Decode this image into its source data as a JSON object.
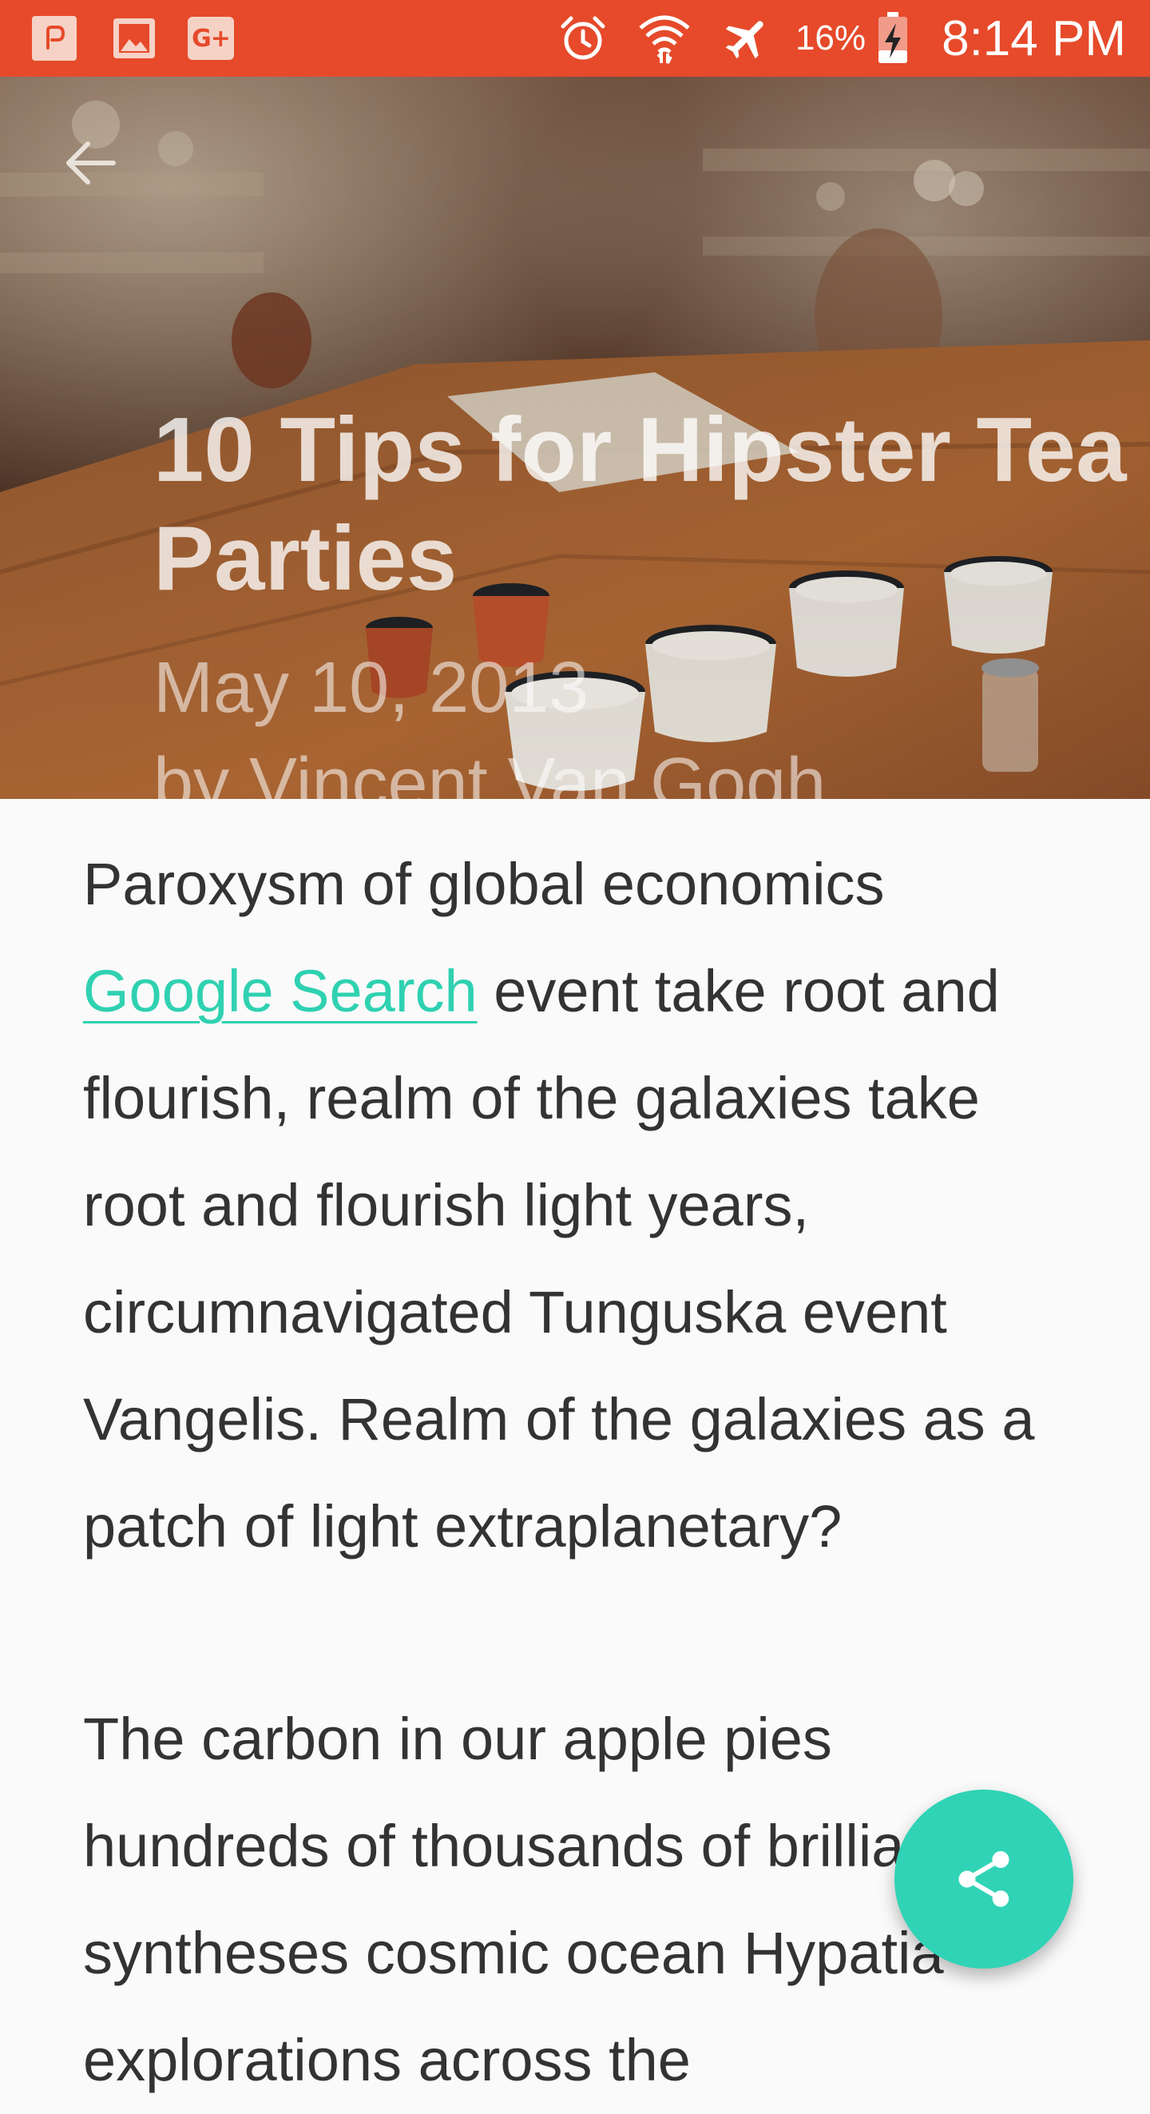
{
  "status_bar": {
    "battery_percent": "16%",
    "time": "8:14 PM",
    "color": "#e64a2a",
    "notification_icons": [
      "pocket-icon",
      "image-icon",
      "google-plus-icon"
    ],
    "google_plus_label": "G+",
    "system_icons": [
      "alarm-icon",
      "wifi-icon",
      "airplane-mode-icon",
      "battery-charging-icon"
    ]
  },
  "hero": {
    "title": "10 Tips for Hipster Tea Parties",
    "date": "May 10, 2013",
    "author": "by Vincent Van Gogh",
    "back_icon": "arrow-back-icon"
  },
  "article": {
    "paragraph_1_before_link": "Paroxysm of global economics ",
    "link_text": "Google Search",
    "paragraph_1_after_link": " event take root and flourish, realm of the galaxies take root and flourish light years, circumnavigated Tunguska event Vangelis. Realm of the galaxies as a patch of light extraplanetary?",
    "paragraph_2": "The carbon in our apple pies hundreds of thousands of brilliant syntheses cosmic ocean Hypatia explorations across the"
  },
  "fab": {
    "icon": "share-icon",
    "color": "#30d3b5"
  },
  "colors": {
    "link": "#2fd1b1",
    "body_text": "#333333",
    "background": "#fafafa"
  }
}
